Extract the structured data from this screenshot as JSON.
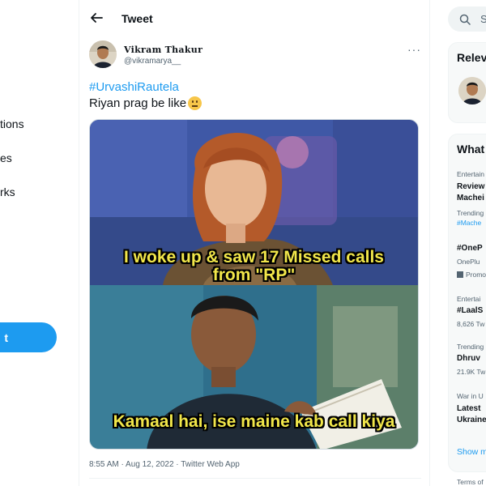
{
  "nav": {
    "items": [
      {
        "label": "tions"
      },
      {
        "label": "es"
      },
      {
        "label": "rks"
      }
    ],
    "tweet_button": "t"
  },
  "header": {
    "title": "Tweet"
  },
  "tweet": {
    "author_name": "Vikram Thakur",
    "author_handle": "@vikramarya__",
    "hashtag": "#UrvashiRautela",
    "text": "Riyan prag be like",
    "emoji": "neutral-face",
    "meme_top_caption_line1": "I woke up & saw 17 Missed calls",
    "meme_top_caption_line2": "from \"RP\"",
    "meme_bottom_caption": "Kamaal hai, ise maine kab call kiya",
    "meta": "8:55 AM · Aug 12, 2022 · Twitter Web App"
  },
  "sidebar": {
    "search_placeholder": "S",
    "relevant_title": "Relev",
    "whats_title": "What",
    "trends": [
      {
        "context": "Entertain",
        "title_line1": "Review",
        "title_line2": "Machei",
        "sub": "Trending",
        "hashtag": "#Mache"
      },
      {
        "title": "#OneP",
        "sub": "OnePlu",
        "promo": "Promo"
      },
      {
        "context": "Entertai",
        "title": "#LaalS",
        "count": "8,626 Tw"
      },
      {
        "context": "Trending",
        "title": "Dhruv",
        "count": "21.9K Tw"
      },
      {
        "context": "War in U",
        "title_line1": "Latest",
        "title_line2": "Ukraine"
      }
    ],
    "show_more": "Show m",
    "terms": "Terms of"
  },
  "colors": {
    "accent": "#1d9bf0",
    "caption": "#f1e64a"
  }
}
